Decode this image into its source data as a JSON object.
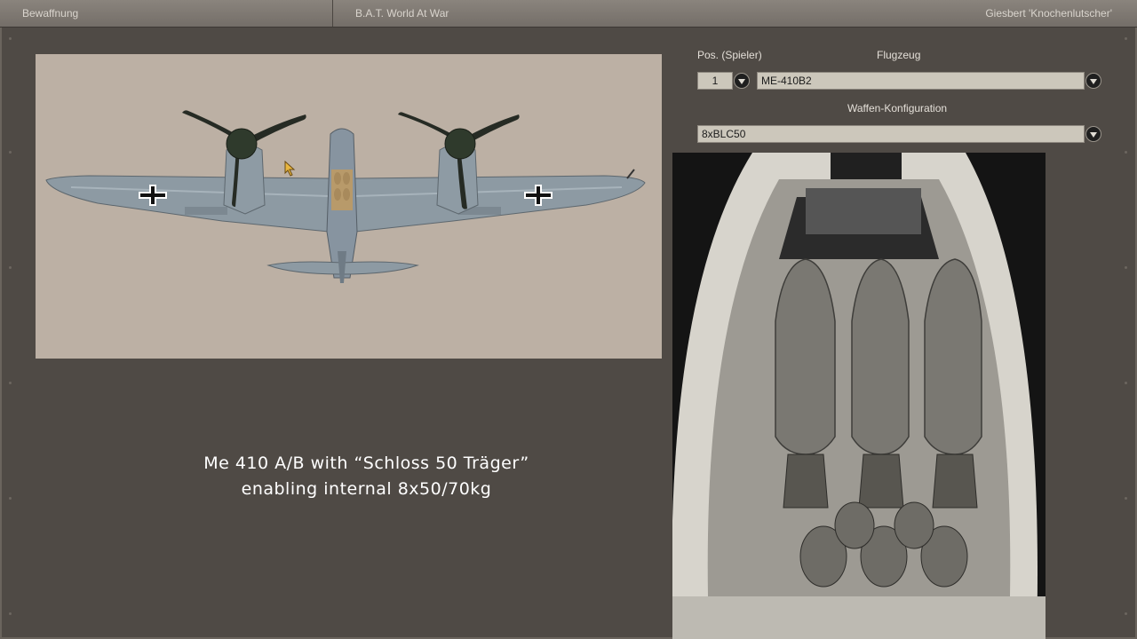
{
  "topbar": {
    "section_title": "Bewaffnung",
    "game_title": "B.A.T. World At War",
    "player_name": "Giesbert 'Knochenlutscher'"
  },
  "form": {
    "position_label": "Pos. (Spieler)",
    "position_value": "1",
    "aircraft_label": "Flugzeug",
    "aircraft_value": "ME-410B2",
    "weapon_config_label": "Waffen-Konfiguration",
    "weapon_config_value": "8xBLC50"
  },
  "caption": {
    "line1": "Me 410 A/B with “Schloss 50 Träger”",
    "line2": "enabling internal 8x50/70kg"
  },
  "icons": {
    "dropdown": "chevron-down-icon",
    "cursor": "mouse-pointer-icon"
  },
  "colors": {
    "background": "#4f4a45",
    "preview_bg": "#bcb0a4",
    "field_bg": "#ccc7bb",
    "topbar": "#7e7872"
  }
}
